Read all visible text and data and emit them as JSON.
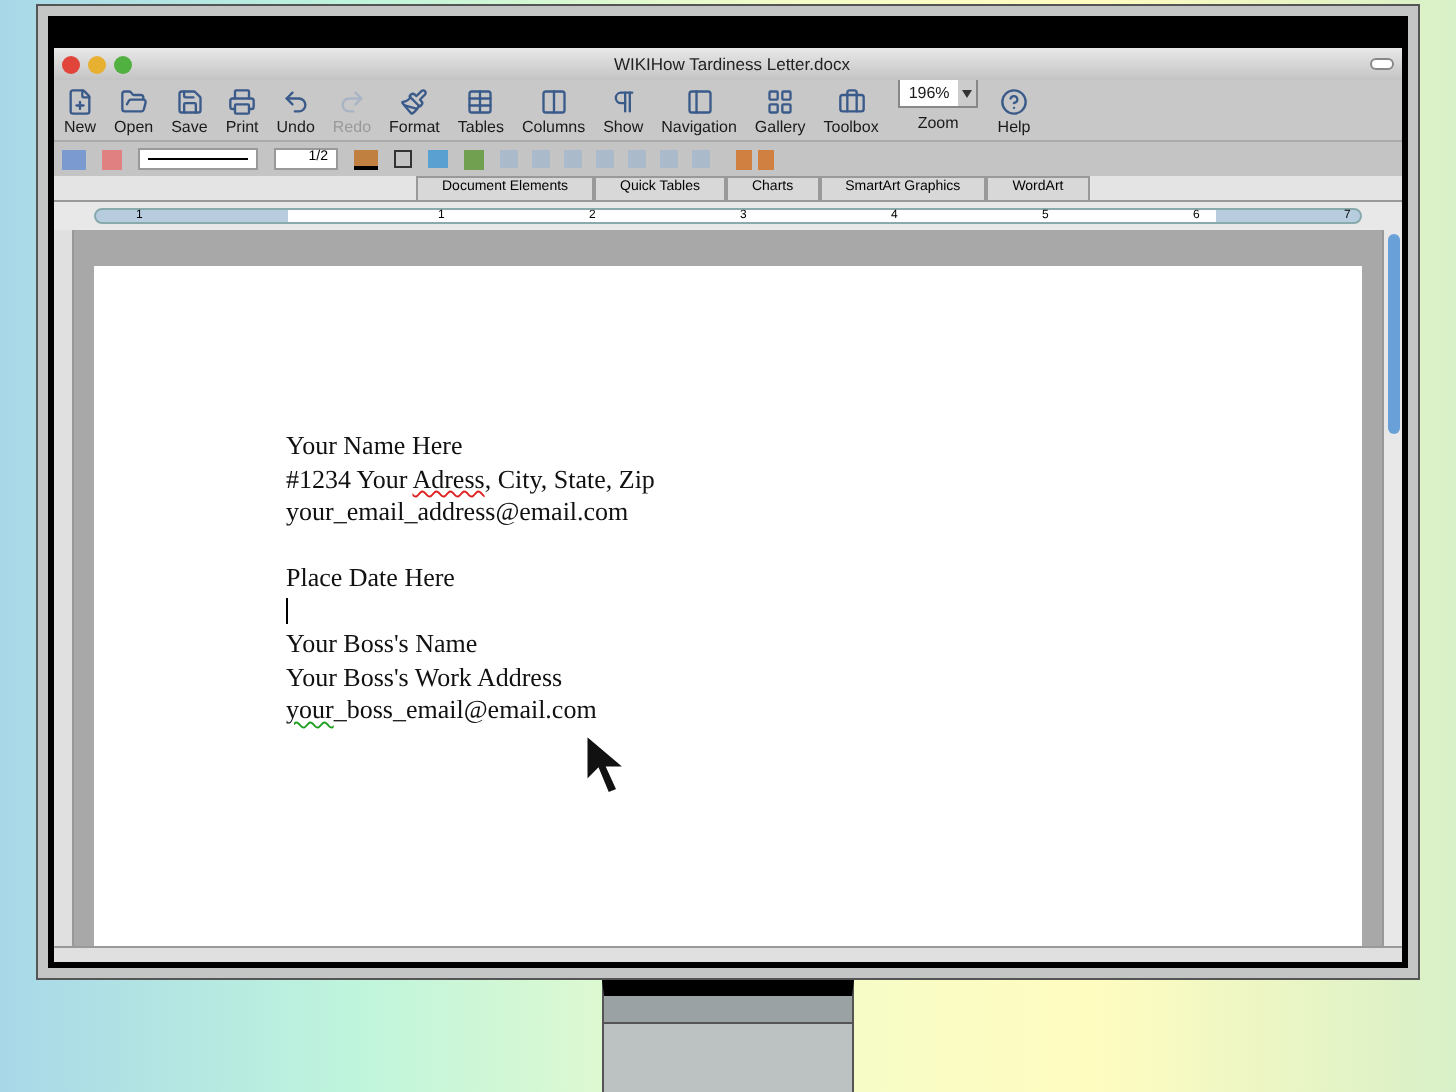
{
  "window": {
    "title": "WIKIHow Tardiness Letter.docx"
  },
  "toolbar": [
    {
      "kind": "button",
      "label": "New",
      "disabled": false
    },
    {
      "kind": "button",
      "label": "Open",
      "disabled": false
    },
    {
      "kind": "button",
      "label": "Save",
      "disabled": false
    },
    {
      "kind": "button",
      "label": "Print",
      "disabled": false
    },
    {
      "kind": "button",
      "label": "Undo",
      "disabled": false
    },
    {
      "kind": "button",
      "label": "Redo",
      "disabled": true
    },
    {
      "kind": "button",
      "label": "Format",
      "disabled": false
    },
    {
      "kind": "button",
      "label": "Tables",
      "disabled": false
    },
    {
      "kind": "button",
      "label": "Columns",
      "disabled": false
    },
    {
      "kind": "button",
      "label": "Show",
      "disabled": false
    },
    {
      "kind": "button",
      "label": "Navigation",
      "disabled": false
    },
    {
      "kind": "button",
      "label": "Gallery",
      "disabled": false
    },
    {
      "kind": "button",
      "label": "Toolbox",
      "disabled": false
    },
    {
      "kind": "zoom",
      "label": "Zoom",
      "value": "196%",
      "disabled": false
    },
    {
      "kind": "button",
      "label": "Help",
      "disabled": false
    }
  ],
  "format_bar": {
    "line_weight": "1/2"
  },
  "ribbon_tabs": [
    {
      "label": "Document Elements",
      "selected": false
    },
    {
      "label": "Quick Tables",
      "selected": false
    },
    {
      "label": "Charts",
      "selected": false
    },
    {
      "label": "SmartArt Graphics",
      "selected": false
    },
    {
      "label": "WordArt",
      "selected": false
    }
  ],
  "ruler": {
    "labels": [
      "1",
      "1",
      "2",
      "3",
      "4",
      "5",
      "6",
      "7"
    ]
  },
  "document": {
    "lines": [
      {
        "kind": "text",
        "segments": [
          {
            "text": "Your Name Here",
            "spelling_error": false,
            "grammar_error": false
          }
        ]
      },
      {
        "kind": "text",
        "segments": [
          {
            "text": "#1234 Your ",
            "spelling_error": false,
            "grammar_error": false
          },
          {
            "text": "Adress",
            "spelling_error": true,
            "grammar_error": false
          },
          {
            "text": ", City, State, Zip",
            "spelling_error": false,
            "grammar_error": false
          }
        ]
      },
      {
        "kind": "text",
        "segments": [
          {
            "text": "your_email_address@email.com",
            "spelling_error": false,
            "grammar_error": false
          }
        ]
      },
      {
        "kind": "blank"
      },
      {
        "kind": "text",
        "segments": [
          {
            "text": "Place Date Here",
            "spelling_error": false,
            "grammar_error": false
          }
        ]
      },
      {
        "kind": "cursor"
      },
      {
        "kind": "text",
        "segments": [
          {
            "text": "Your Boss's Name",
            "spelling_error": false,
            "grammar_error": false
          }
        ]
      },
      {
        "kind": "text",
        "segments": [
          {
            "text": "Your Boss's Work Address",
            "spelling_error": false,
            "grammar_error": false
          }
        ]
      },
      {
        "kind": "text",
        "segments": [
          {
            "text": "your",
            "spelling_error": false,
            "grammar_error": true
          },
          {
            "text": "_boss_email@email.com",
            "spelling_error": false,
            "grammar_error": false
          }
        ]
      }
    ]
  }
}
